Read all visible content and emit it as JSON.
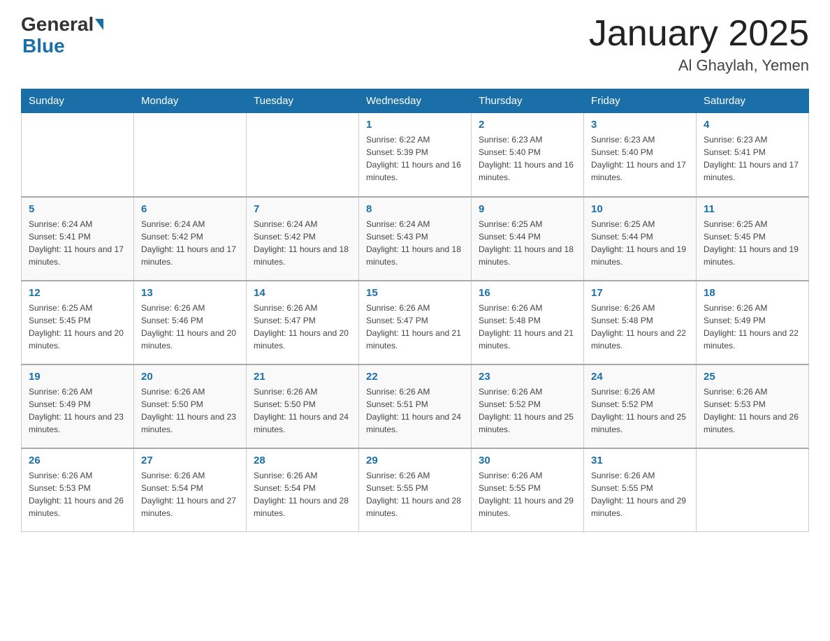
{
  "header": {
    "logo_main": "General",
    "logo_sub": "Blue",
    "title": "January 2025",
    "subtitle": "Al Ghaylah, Yemen"
  },
  "weekdays": [
    "Sunday",
    "Monday",
    "Tuesday",
    "Wednesday",
    "Thursday",
    "Friday",
    "Saturday"
  ],
  "weeks": [
    [
      {
        "day": "",
        "info": ""
      },
      {
        "day": "",
        "info": ""
      },
      {
        "day": "",
        "info": ""
      },
      {
        "day": "1",
        "info": "Sunrise: 6:22 AM\nSunset: 5:39 PM\nDaylight: 11 hours and 16 minutes."
      },
      {
        "day": "2",
        "info": "Sunrise: 6:23 AM\nSunset: 5:40 PM\nDaylight: 11 hours and 16 minutes."
      },
      {
        "day": "3",
        "info": "Sunrise: 6:23 AM\nSunset: 5:40 PM\nDaylight: 11 hours and 17 minutes."
      },
      {
        "day": "4",
        "info": "Sunrise: 6:23 AM\nSunset: 5:41 PM\nDaylight: 11 hours and 17 minutes."
      }
    ],
    [
      {
        "day": "5",
        "info": "Sunrise: 6:24 AM\nSunset: 5:41 PM\nDaylight: 11 hours and 17 minutes."
      },
      {
        "day": "6",
        "info": "Sunrise: 6:24 AM\nSunset: 5:42 PM\nDaylight: 11 hours and 17 minutes."
      },
      {
        "day": "7",
        "info": "Sunrise: 6:24 AM\nSunset: 5:42 PM\nDaylight: 11 hours and 18 minutes."
      },
      {
        "day": "8",
        "info": "Sunrise: 6:24 AM\nSunset: 5:43 PM\nDaylight: 11 hours and 18 minutes."
      },
      {
        "day": "9",
        "info": "Sunrise: 6:25 AM\nSunset: 5:44 PM\nDaylight: 11 hours and 18 minutes."
      },
      {
        "day": "10",
        "info": "Sunrise: 6:25 AM\nSunset: 5:44 PM\nDaylight: 11 hours and 19 minutes."
      },
      {
        "day": "11",
        "info": "Sunrise: 6:25 AM\nSunset: 5:45 PM\nDaylight: 11 hours and 19 minutes."
      }
    ],
    [
      {
        "day": "12",
        "info": "Sunrise: 6:25 AM\nSunset: 5:45 PM\nDaylight: 11 hours and 20 minutes."
      },
      {
        "day": "13",
        "info": "Sunrise: 6:26 AM\nSunset: 5:46 PM\nDaylight: 11 hours and 20 minutes."
      },
      {
        "day": "14",
        "info": "Sunrise: 6:26 AM\nSunset: 5:47 PM\nDaylight: 11 hours and 20 minutes."
      },
      {
        "day": "15",
        "info": "Sunrise: 6:26 AM\nSunset: 5:47 PM\nDaylight: 11 hours and 21 minutes."
      },
      {
        "day": "16",
        "info": "Sunrise: 6:26 AM\nSunset: 5:48 PM\nDaylight: 11 hours and 21 minutes."
      },
      {
        "day": "17",
        "info": "Sunrise: 6:26 AM\nSunset: 5:48 PM\nDaylight: 11 hours and 22 minutes."
      },
      {
        "day": "18",
        "info": "Sunrise: 6:26 AM\nSunset: 5:49 PM\nDaylight: 11 hours and 22 minutes."
      }
    ],
    [
      {
        "day": "19",
        "info": "Sunrise: 6:26 AM\nSunset: 5:49 PM\nDaylight: 11 hours and 23 minutes."
      },
      {
        "day": "20",
        "info": "Sunrise: 6:26 AM\nSunset: 5:50 PM\nDaylight: 11 hours and 23 minutes."
      },
      {
        "day": "21",
        "info": "Sunrise: 6:26 AM\nSunset: 5:50 PM\nDaylight: 11 hours and 24 minutes."
      },
      {
        "day": "22",
        "info": "Sunrise: 6:26 AM\nSunset: 5:51 PM\nDaylight: 11 hours and 24 minutes."
      },
      {
        "day": "23",
        "info": "Sunrise: 6:26 AM\nSunset: 5:52 PM\nDaylight: 11 hours and 25 minutes."
      },
      {
        "day": "24",
        "info": "Sunrise: 6:26 AM\nSunset: 5:52 PM\nDaylight: 11 hours and 25 minutes."
      },
      {
        "day": "25",
        "info": "Sunrise: 6:26 AM\nSunset: 5:53 PM\nDaylight: 11 hours and 26 minutes."
      }
    ],
    [
      {
        "day": "26",
        "info": "Sunrise: 6:26 AM\nSunset: 5:53 PM\nDaylight: 11 hours and 26 minutes."
      },
      {
        "day": "27",
        "info": "Sunrise: 6:26 AM\nSunset: 5:54 PM\nDaylight: 11 hours and 27 minutes."
      },
      {
        "day": "28",
        "info": "Sunrise: 6:26 AM\nSunset: 5:54 PM\nDaylight: 11 hours and 28 minutes."
      },
      {
        "day": "29",
        "info": "Sunrise: 6:26 AM\nSunset: 5:55 PM\nDaylight: 11 hours and 28 minutes."
      },
      {
        "day": "30",
        "info": "Sunrise: 6:26 AM\nSunset: 5:55 PM\nDaylight: 11 hours and 29 minutes."
      },
      {
        "day": "31",
        "info": "Sunrise: 6:26 AM\nSunset: 5:55 PM\nDaylight: 11 hours and 29 minutes."
      },
      {
        "day": "",
        "info": ""
      }
    ]
  ],
  "colors": {
    "header_bg": "#1a6fa8",
    "accent": "#1a6fa8"
  }
}
